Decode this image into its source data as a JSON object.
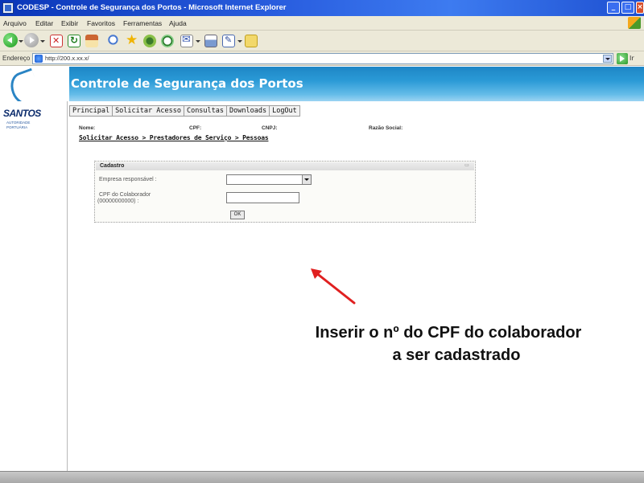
{
  "window": {
    "title": "CODESP - Controle de Segurança dos Portos - Microsoft Internet Explorer",
    "controls": {
      "minimize": "_",
      "maximize": "□",
      "close": "×"
    }
  },
  "menu": {
    "items": [
      "Arquivo",
      "Editar",
      "Exibir",
      "Favoritos",
      "Ferramentas",
      "Ajuda"
    ]
  },
  "toolbar": {
    "icons": [
      "back-icon",
      "forward-icon",
      "stop-icon",
      "refresh-icon",
      "home-icon",
      "search-icon",
      "favorites-icon",
      "media-icon",
      "history-icon",
      "mail-icon",
      "print-icon",
      "edit-icon",
      "messenger-icon"
    ]
  },
  "address": {
    "label": "Endereço",
    "url": "http://200.x.xx.x/",
    "go_label": "Ir"
  },
  "app": {
    "title": "Controle de Segurança dos Portos",
    "logo": "SANTOS",
    "logo_subtitle": "AUTORIDADE PORTUÁRIA",
    "header_color": "#2a9ad6"
  },
  "nav": {
    "tabs": [
      "Principal",
      "Solicitar Acesso",
      "Consultas",
      "Downloads",
      "LogOut"
    ]
  },
  "user_info": {
    "nome_label": "Nome:",
    "cpf_label": "CPF:",
    "cnpj_label": "CNPJ:",
    "razao_label": "Razão Social:"
  },
  "breadcrumb": "Solicitar Acesso > Prestadores de Serviço > Pessoas",
  "form": {
    "title": "Cadastro",
    "empresa_label": "Empresa responsável :",
    "empresa_value": "",
    "cpf_label_line1": "CPF do Colaborador",
    "cpf_label_line2": "(00000000000) :",
    "cpf_value": "",
    "submit_label": "OK"
  },
  "annotation": {
    "line1": "Inserir o nº do CPF do colaborador",
    "line2": "a ser cadastrado",
    "arrow_color": "#e02020"
  }
}
